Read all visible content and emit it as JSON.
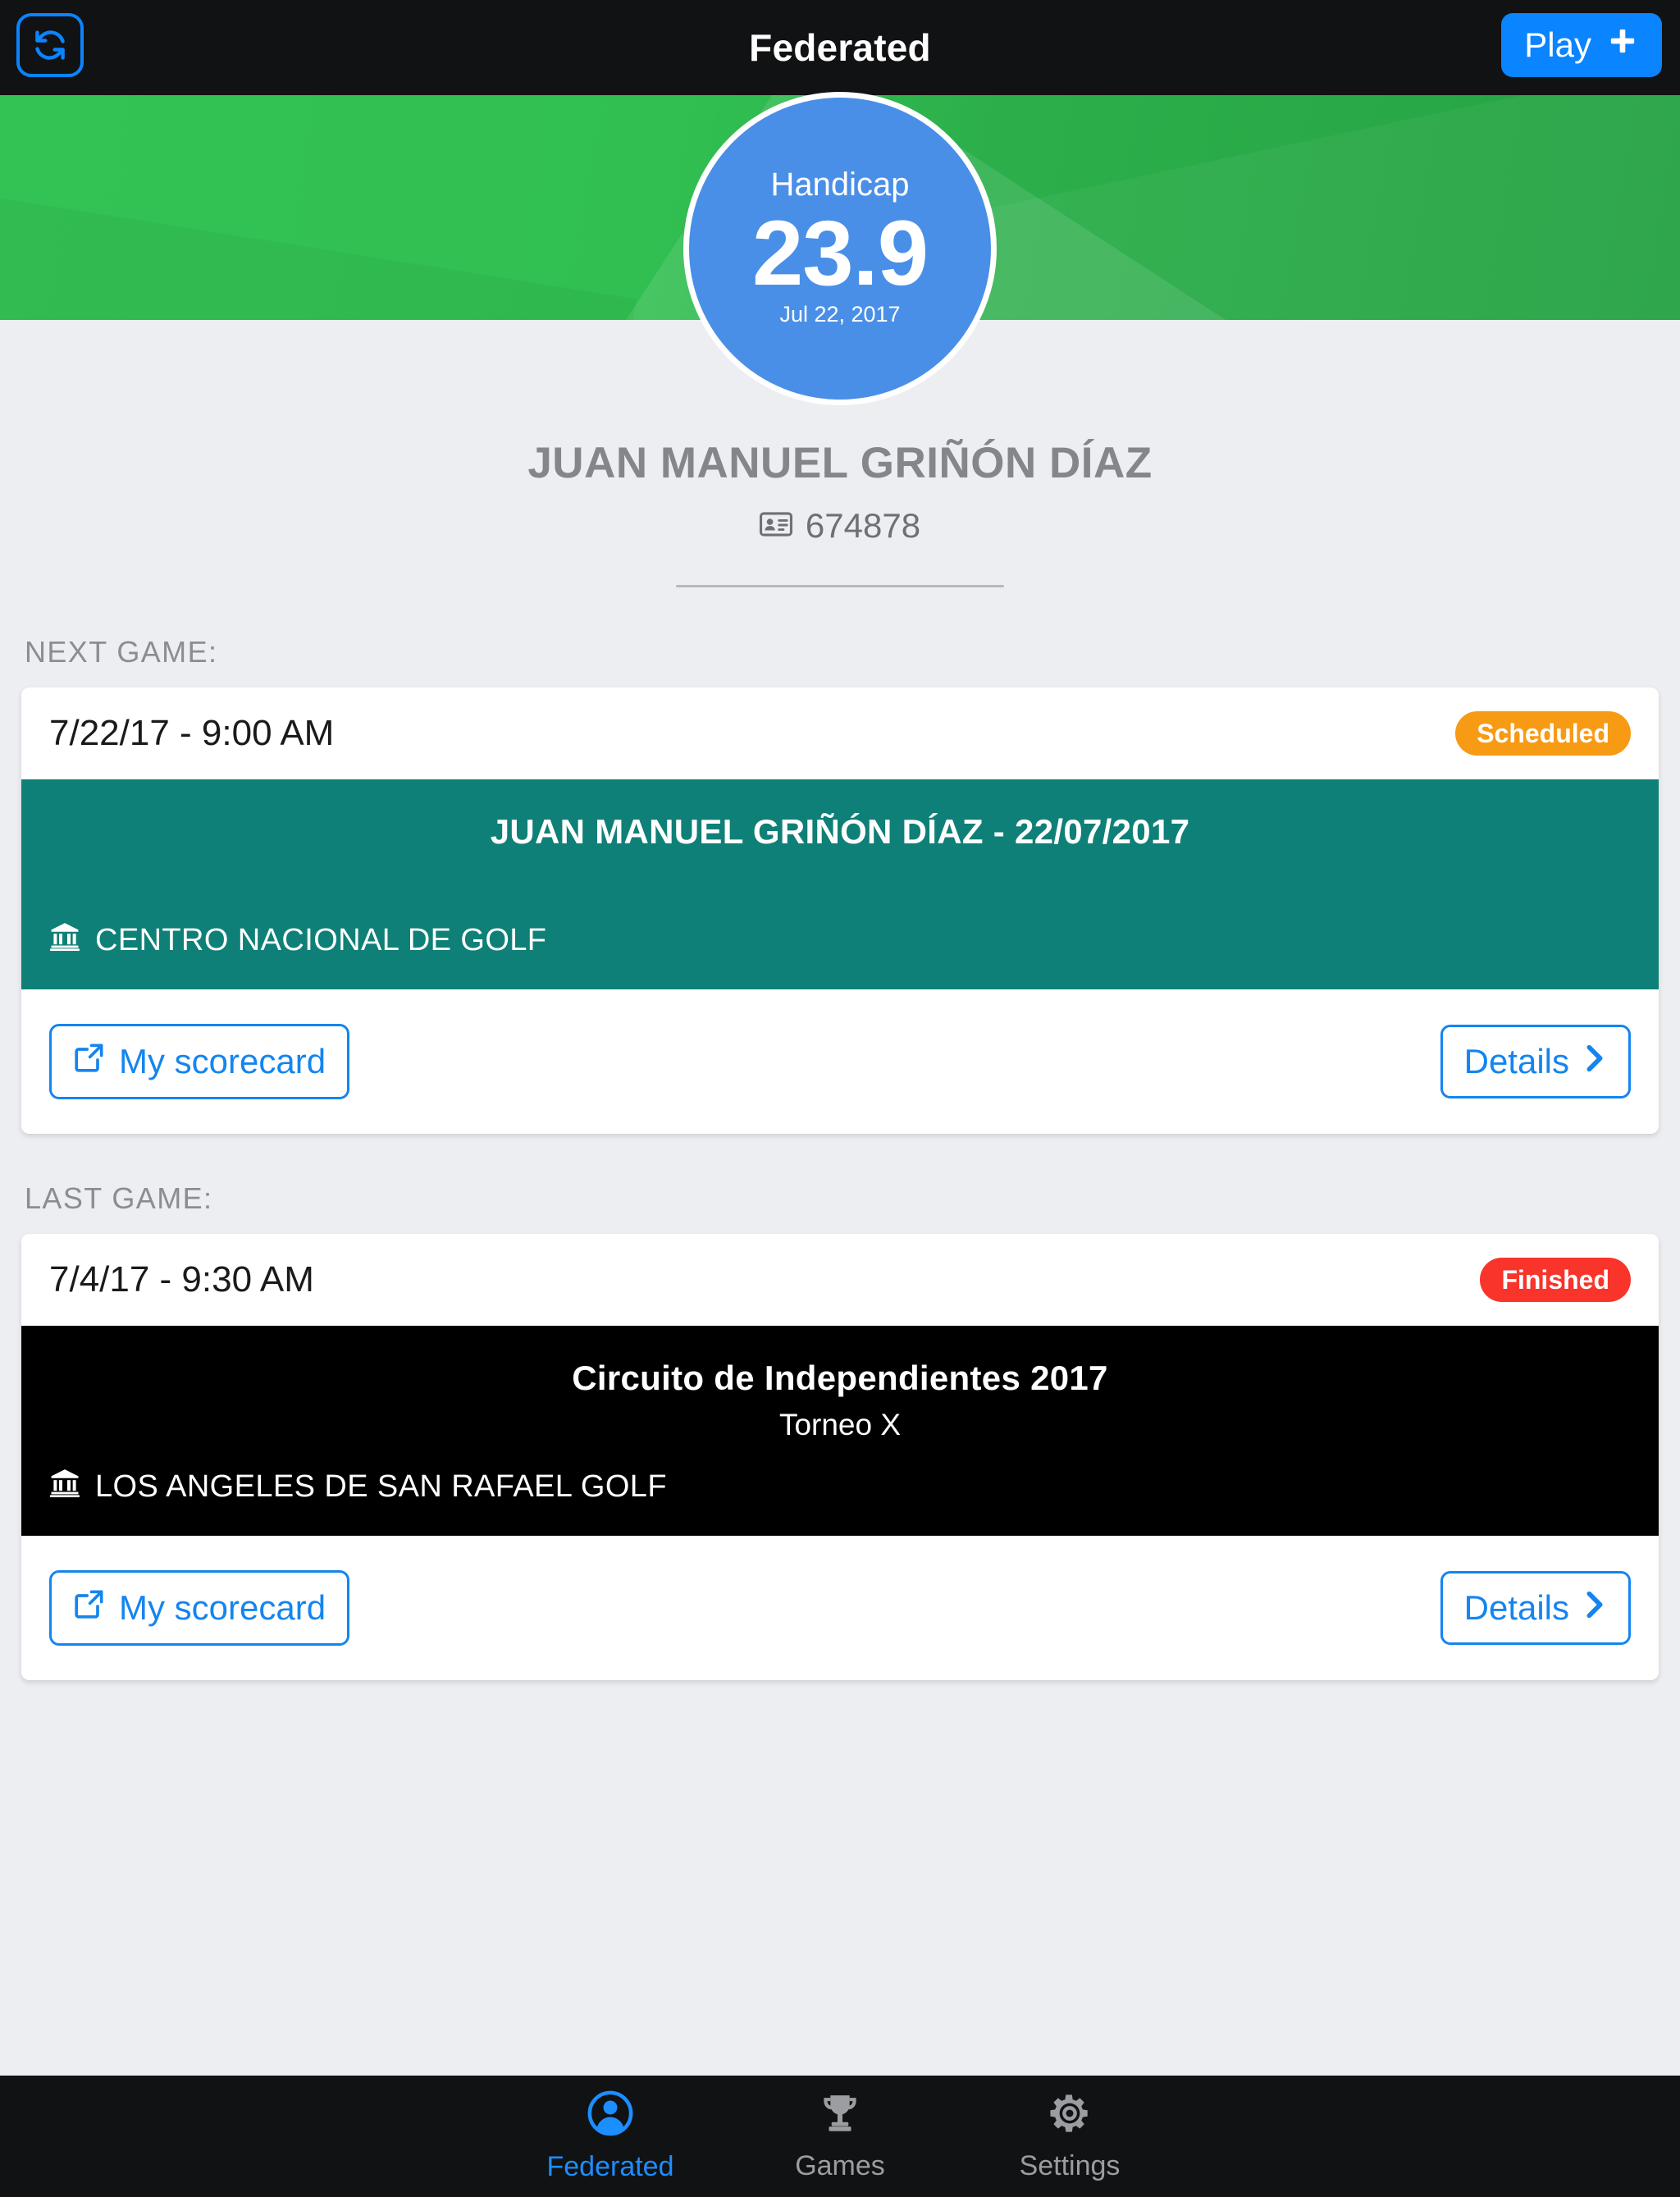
{
  "navbar": {
    "title": "Federated",
    "refresh_icon": "refresh-icon",
    "play_label": "Play",
    "play_plus": "✚"
  },
  "handicap": {
    "label": "Handicap",
    "value": "23.9",
    "date": "Jul 22, 2017"
  },
  "profile": {
    "name": "JUAN MANUEL GRIÑÓN DÍAZ",
    "id_icon": "id-card-icon",
    "id_number": "674878"
  },
  "next_game": {
    "section_label": "NEXT GAME:",
    "date": "7/22/17 - 9:00 AM",
    "status": "Scheduled",
    "status_color": "#f79a14",
    "banner_color": "#0f8077",
    "title": "JUAN MANUEL GRIÑÓN DÍAZ - 22/07/2017",
    "subtitle": "",
    "venue_icon": "bank-icon",
    "venue": "CENTRO NACIONAL DE GOLF",
    "scorecard_icon": "external-link-icon",
    "scorecard_label": "My scorecard",
    "details_label": "Details",
    "details_icon": "chevron-right-icon"
  },
  "last_game": {
    "section_label": "LAST GAME:",
    "date": "7/4/17 - 9:30 AM",
    "status": "Finished",
    "status_color": "#f8342b",
    "banner_color": "#000000",
    "title": "Circuito de Independientes 2017",
    "subtitle": "Torneo X",
    "venue_icon": "bank-icon",
    "venue": "LOS ANGELES DE SAN RAFAEL GOLF",
    "scorecard_icon": "external-link-icon",
    "scorecard_label": "My scorecard",
    "details_label": "Details",
    "details_icon": "chevron-right-icon"
  },
  "tabbar": {
    "tabs": [
      {
        "label": "Federated",
        "icon": "person-circle-icon",
        "active": true
      },
      {
        "label": "Games",
        "icon": "trophy-icon",
        "active": false
      },
      {
        "label": "Settings",
        "icon": "gear-icon",
        "active": false
      }
    ],
    "active_color": "#1d8eff",
    "idle_color": "#9b9da1"
  },
  "theme": {
    "hero_green": "#33c254",
    "handicap_blue": "#4a8fe7",
    "accent_blue": "#0a84ff",
    "page_bg": "#eceef1"
  }
}
